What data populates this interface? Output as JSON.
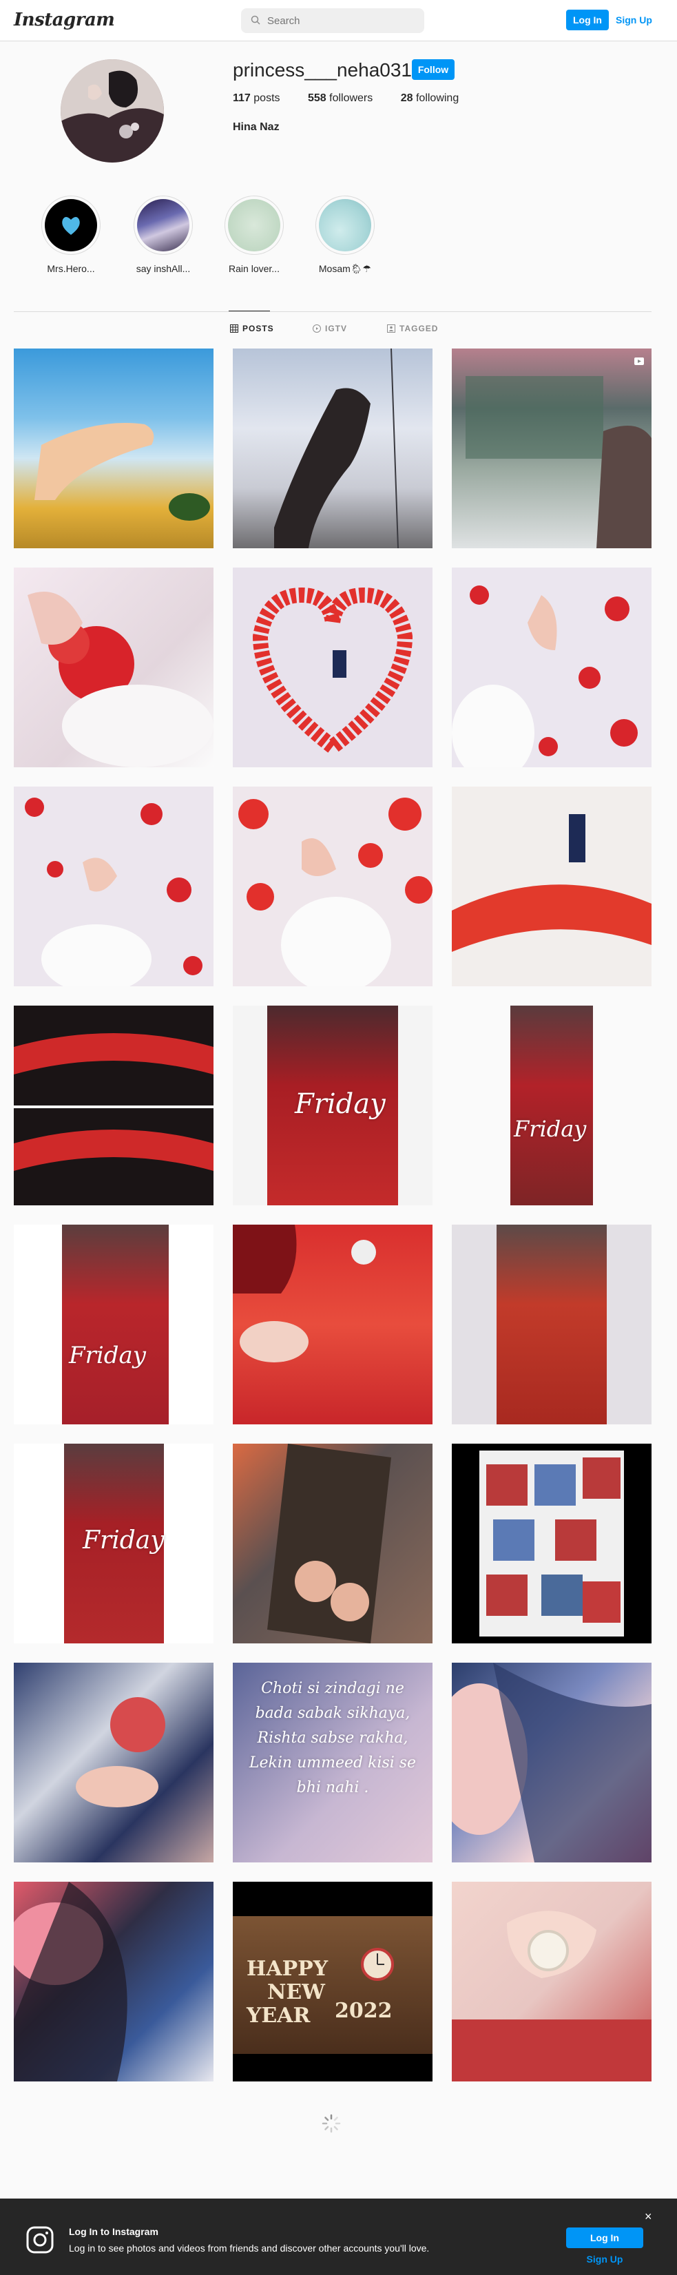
{
  "header": {
    "logo_text": "Instagram",
    "search_placeholder": "Search",
    "login_label": "Log In",
    "signup_label": "Sign Up"
  },
  "profile": {
    "username": "princess___neha0317",
    "follow_label": "Follow",
    "posts_count": "117",
    "posts_label": "posts",
    "followers_count": "558",
    "followers_label": "followers",
    "following_count": "28",
    "following_label": "following",
    "full_name": "Hina Naz"
  },
  "highlights": [
    {
      "label": "Mrs.Hero..."
    },
    {
      "label": "say inshAll..."
    },
    {
      "label": "Rain lover..."
    },
    {
      "label": "Mosam🌦☂"
    }
  ],
  "tabs": [
    {
      "label": "POSTS",
      "icon": "grid-icon"
    },
    {
      "label": "IGTV",
      "icon": "igtv-icon"
    },
    {
      "label": "TAGGED",
      "icon": "tagged-icon"
    }
  ],
  "posts": {
    "caption_friday": "Friday",
    "caption_quote": "Choti si zindagi ne bada sabak sikhaya, Rishta sabse rakha, Lekin ummeed kisi se bhi nahi .",
    "caption_happy": "HAPPY",
    "caption_new": "NEW",
    "caption_year": "YEAR",
    "caption_2022": "2022"
  },
  "login_banner": {
    "title": "Log In to Instagram",
    "subtitle": "Log in to see photos and videos from friends and discover other accounts you'll love.",
    "login_label": "Log In",
    "signup_label": "Sign Up",
    "close_glyph": "×"
  }
}
